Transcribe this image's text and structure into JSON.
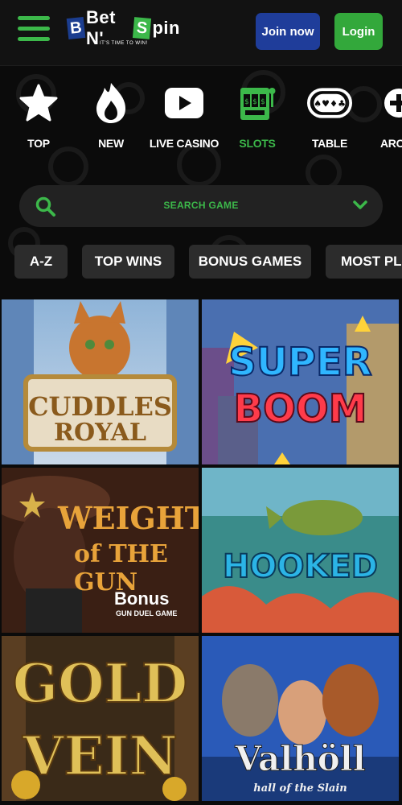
{
  "header": {
    "logo": {
      "text_left": "Bet N'",
      "text_right": "pin",
      "tagline": "IT'S TIME TO WIN!",
      "box_b": "B",
      "box_s": "S"
    },
    "join_label": "Join now",
    "login_label": "Login"
  },
  "categories": [
    {
      "label": "TOP",
      "icon": "star-icon"
    },
    {
      "label": "NEW",
      "icon": "flame-icon"
    },
    {
      "label": "LIVE CASINO",
      "icon": "play-icon"
    },
    {
      "label": "SLOTS",
      "icon": "slot-machine-icon",
      "active": true
    },
    {
      "label": "TABLE",
      "icon": "cards-icon"
    },
    {
      "label": "ARC",
      "icon": "plus-icon"
    }
  ],
  "search": {
    "placeholder": "SEARCH GAME"
  },
  "filters": [
    "A-Z",
    "TOP WINS",
    "BONUS GAMES",
    "MOST PL"
  ],
  "games": [
    {
      "title_line1": "CUDDLES",
      "title_line2": "ROYAL"
    },
    {
      "title_line1": "SUPER",
      "title_line2": "BOOM"
    },
    {
      "title_line1": "WEIGHT",
      "title_line2": "of THE GUN",
      "badge": "Bonus",
      "badge_sub": "GUN DUEL GAME"
    },
    {
      "title_line1": "HOOKED",
      "title_line2": ""
    },
    {
      "title_line1": "GOLD",
      "title_line2": "VEIN"
    },
    {
      "title_line1": "Valhöll",
      "title_line2": "hall of the Slain"
    }
  ],
  "colors": {
    "brand_green": "#3cb84a",
    "brand_blue": "#1f3d9a",
    "background": "#0b0b0b"
  }
}
